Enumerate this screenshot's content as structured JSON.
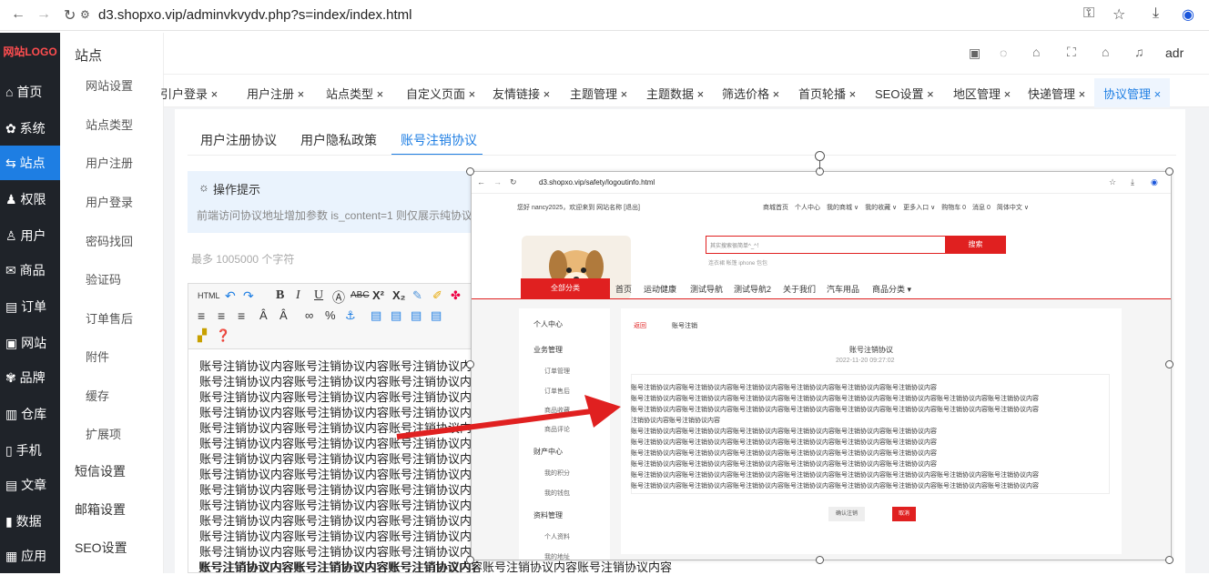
{
  "browser": {
    "url": "d3.shopxo.vip/adminvkvydv.php?s=index/index.html"
  },
  "leftnav": {
    "logo": "网站LOGO",
    "items": [
      {
        "label": "首页"
      },
      {
        "label": "系统"
      },
      {
        "label": "站点"
      },
      {
        "label": "权限"
      },
      {
        "label": "用户"
      },
      {
        "label": "商品"
      },
      {
        "label": "订单"
      },
      {
        "label": "网站"
      },
      {
        "label": "品牌"
      },
      {
        "label": "仓库"
      },
      {
        "label": "手机"
      },
      {
        "label": "文章"
      },
      {
        "label": "数据"
      },
      {
        "label": "应用"
      }
    ]
  },
  "subnav": {
    "title": "站点",
    "items": [
      "网站设置",
      "站点类型",
      "用户注册",
      "用户登录",
      "密码找回",
      "验证码",
      "订单售后",
      "附件",
      "缓存",
      "扩展项"
    ],
    "sections": [
      "短信设置",
      "邮箱设置",
      "SEO设置"
    ]
  },
  "topbar": {
    "admin_text": "adr"
  },
  "tabs": [
    "引户登录 ×",
    "用户注册 ×",
    "站点类型 ×",
    "自定义页面 ×",
    "友情链接 ×",
    "主题管理 ×",
    "主题数据 ×",
    "筛选价格 ×",
    "首页轮播 ×",
    "SEO设置 ×",
    "地区管理 ×",
    "快递管理 ×",
    "协议管理 ×"
  ],
  "subtabs": [
    "用户注册协议",
    "用户隐私政策",
    "账号注销协议"
  ],
  "tip": {
    "title": "操作提示",
    "text": "前端访问协议地址增加参数 is_content=1 则仅展示纯协议内容"
  },
  "editor": {
    "limit_hint": "最多 1005000 个字符",
    "line": "账号注销协议内容账号注销协议内容账号注销协议内容",
    "last_line": "账号注销协议内容账号注销协议内容账号注销协议内容账号注销协议内容账号注销协议内容"
  },
  "popup": {
    "url": "d3.shopxo.vip/safety/logoutinfo.html",
    "top_left": "您好 nancy2025，欢迎来到 网站名称 [退出]",
    "top_links": "商城首页　个人中心　我的商城 ∨　我的收藏 ∨　更多入口 ∨　购物车 0　消息 0　简体中文 ∨",
    "search_placeholder": "其实搜索很简单^_^！",
    "search_button": "搜索",
    "hot_words": "连衣裙  帐篷  iphone  包包",
    "all_categories": "全部分类",
    "nav_items": [
      "首页",
      "运动健康",
      "测试导航",
      "测试导航2",
      "关于我们",
      "汽车用品",
      "商品分类 ▾"
    ],
    "sidebar": {
      "user_center": "个人中心",
      "business": "业务管理",
      "business_items": [
        "订单管理",
        "订单售后",
        "商品收藏",
        "商品评论"
      ],
      "finance": "财产中心",
      "finance_items": [
        "我的积分",
        "我的钱包"
      ],
      "profile": "资料管理",
      "profile_items": [
        "个人资料",
        "我的地址"
      ]
    },
    "breadcrumb_back": "返回",
    "breadcrumb_current": "账号注销",
    "title": "账号注销协议",
    "date": "2022-11-20 09:27:02",
    "content_line_short": "账号注销协议内容账号注销协议内容账号注销协议内容账号注销协议内容账号注销协议内容账号注销协议内容",
    "content_line_long": "账号注销协议内容账号注销协议内容账号注销协议内容账号注销协议内容账号注销协议内容账号注销协议内容账号注销协议内容账号注销协议内容",
    "content_line_tail": "注销协议内容账号注销协议内容",
    "confirm_button": "确认注销",
    "cancel_button": "取消"
  },
  "colors": {
    "accent": "#1e7ee3",
    "brand_red": "#e02020",
    "leftnav_bg": "#1f2329"
  }
}
